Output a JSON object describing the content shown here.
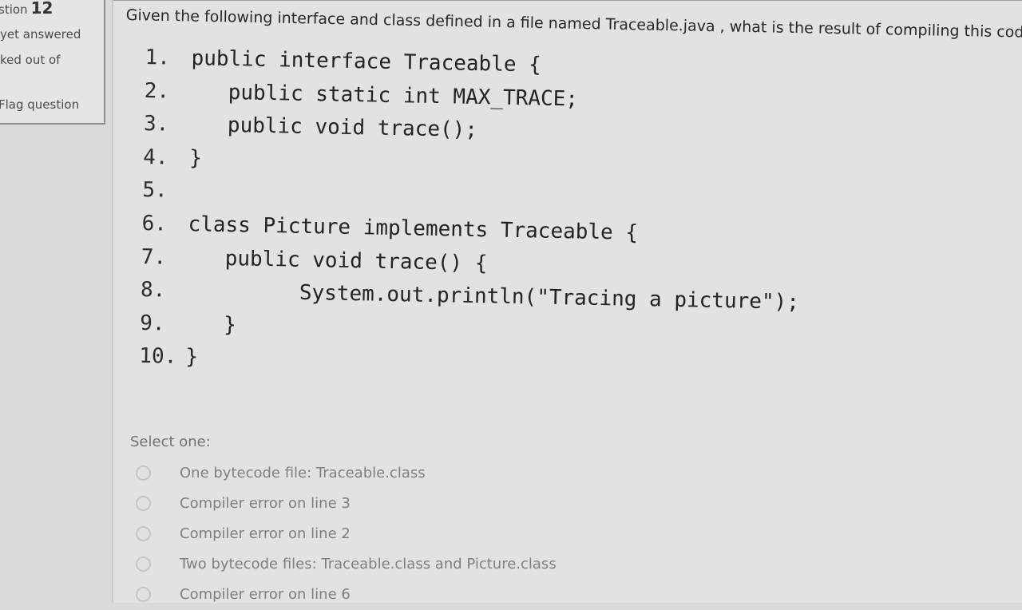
{
  "sidebar": {
    "question_prefix": "stion",
    "question_number": "12",
    "status": "yet answered",
    "marks": "ked out of",
    "flag": "Flag question"
  },
  "question": {
    "text": "Given the following interface and class defined in a file named Traceable.java , what is the result of compiling this code?"
  },
  "code": [
    {
      "num": "1.",
      "text": "public interface Traceable {"
    },
    {
      "num": "2.",
      "text": "   public static int MAX_TRACE;"
    },
    {
      "num": "3.",
      "text": "   public void trace();"
    },
    {
      "num": "4.",
      "text": "}"
    },
    {
      "num": "5.",
      "text": ""
    },
    {
      "num": "6.",
      "text": "class Picture implements Traceable {"
    },
    {
      "num": "7.",
      "text": "   public void trace() {"
    },
    {
      "num": "8.",
      "text": "         System.out.println(\"Tracing a picture\");"
    },
    {
      "num": "9.",
      "text": "   }"
    },
    {
      "num": "10.",
      "text": "}"
    }
  ],
  "answers": {
    "prompt": "Select one:",
    "options": [
      "One bytecode file: Traceable.class",
      "Compiler error on line 3",
      "Compiler error on line 2",
      "Two bytecode files: Traceable.class and Picture.class",
      "Compiler error on line 6"
    ]
  }
}
